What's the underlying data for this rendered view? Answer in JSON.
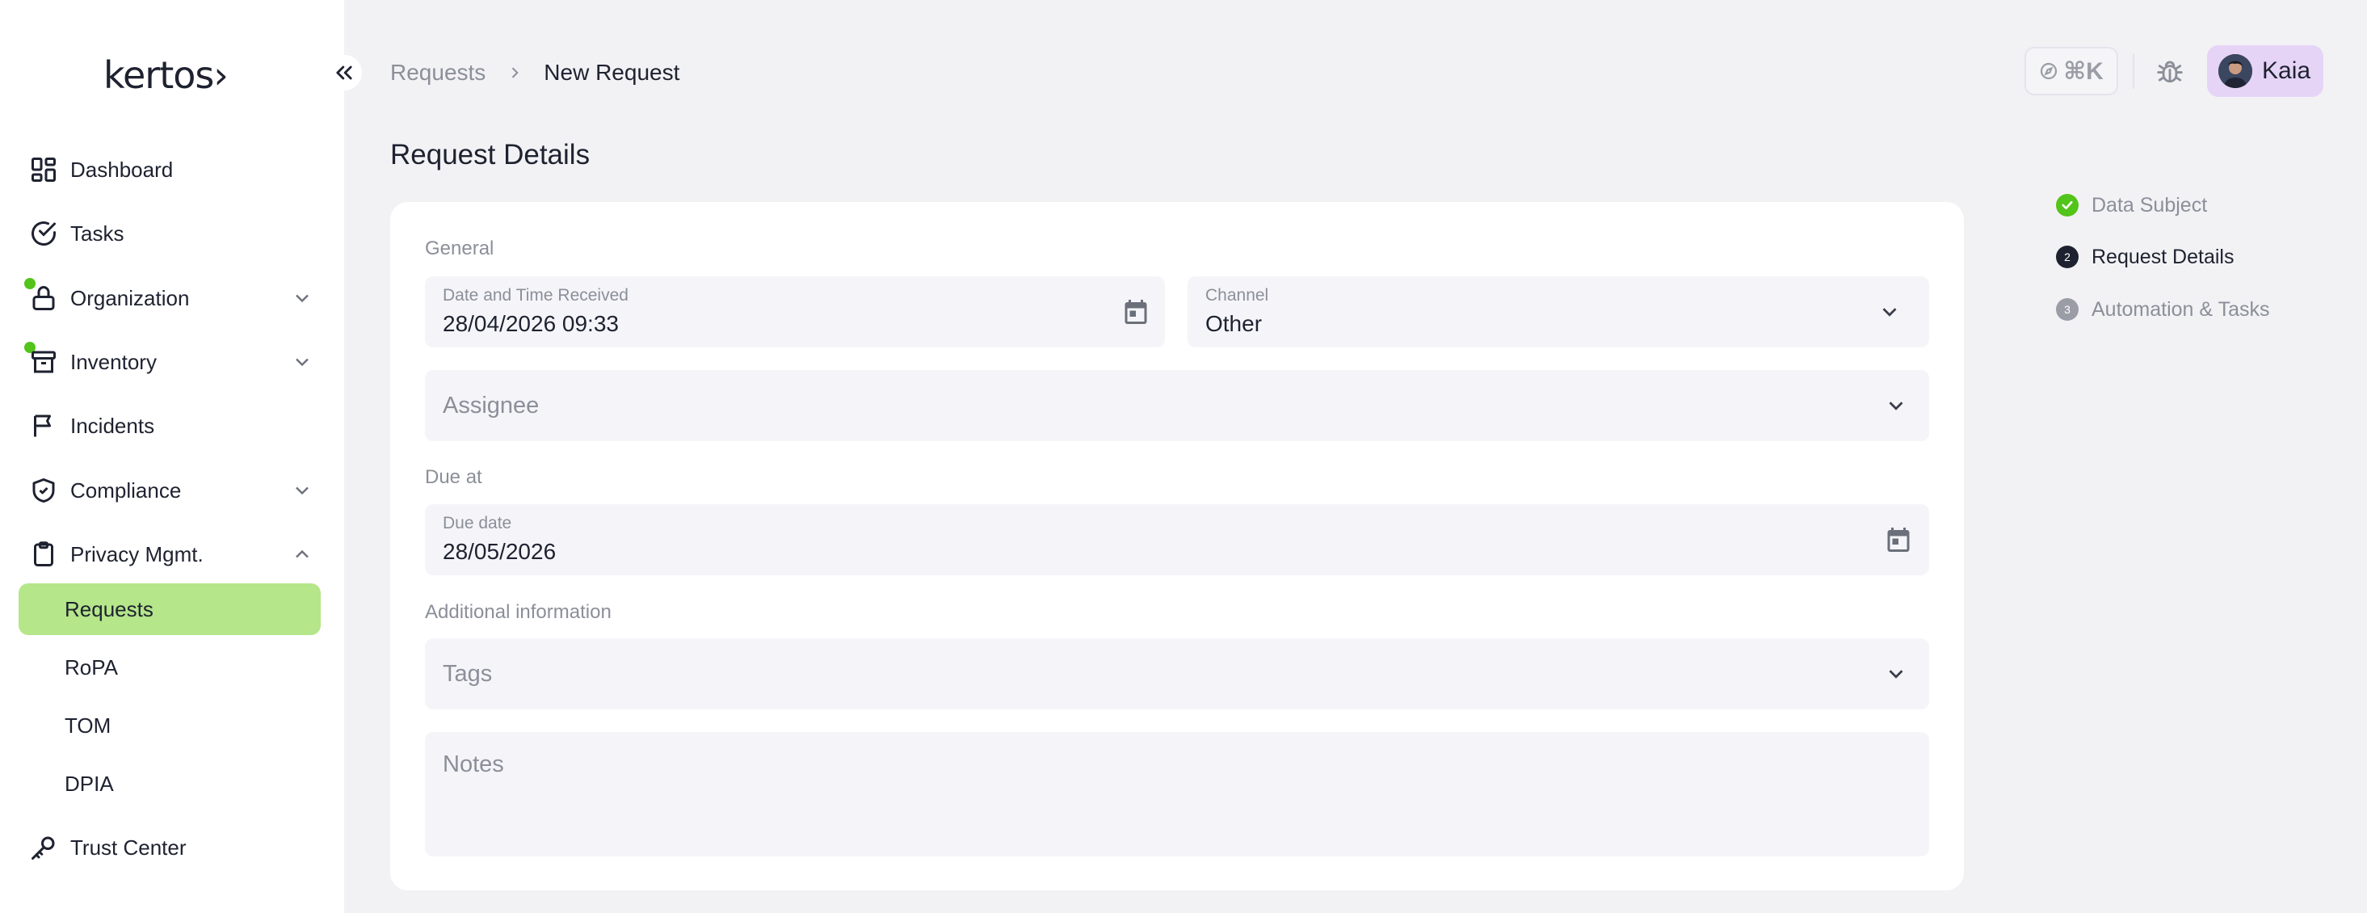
{
  "brand": {
    "logo_text": "kertos›"
  },
  "sidebar": {
    "items": [
      {
        "label": "Dashboard"
      },
      {
        "label": "Tasks"
      },
      {
        "label": "Organization"
      },
      {
        "label": "Inventory"
      },
      {
        "label": "Incidents"
      },
      {
        "label": "Compliance"
      },
      {
        "label": "Privacy Mgmt."
      }
    ],
    "sub_items": [
      {
        "label": "Requests",
        "active": true
      },
      {
        "label": "RoPA"
      },
      {
        "label": "TOM"
      },
      {
        "label": "DPIA"
      }
    ],
    "footer_item": {
      "label": "Trust Center"
    }
  },
  "header": {
    "breadcrumb": [
      "Requests",
      "New Request"
    ],
    "shortcut_label": "⌘K",
    "user_name": "Kaia"
  },
  "main": {
    "title": "Request Details",
    "general_label": "General",
    "date_received": {
      "caption": "Date and Time Received",
      "value": "28/04/2026 09:33"
    },
    "channel": {
      "caption": "Channel",
      "value": "Other"
    },
    "assignee": {
      "placeholder": "Assignee"
    },
    "due_label": "Due at",
    "due_date": {
      "caption": "Due date",
      "value": "28/05/2026"
    },
    "additional_label": "Additional information",
    "tags": {
      "placeholder": "Tags"
    },
    "notes": {
      "placeholder": "Notes"
    }
  },
  "stepper": {
    "steps": [
      {
        "label": "Data Subject",
        "state": "done",
        "marker": ""
      },
      {
        "label": "Request Details",
        "state": "current",
        "marker": "2"
      },
      {
        "label": "Automation & Tasks",
        "state": "upcoming",
        "marker": "3"
      }
    ]
  },
  "colors": {
    "accent_green": "#b5e68a",
    "status_dot": "#52c41a",
    "user_chip": "#e6d4f7"
  }
}
